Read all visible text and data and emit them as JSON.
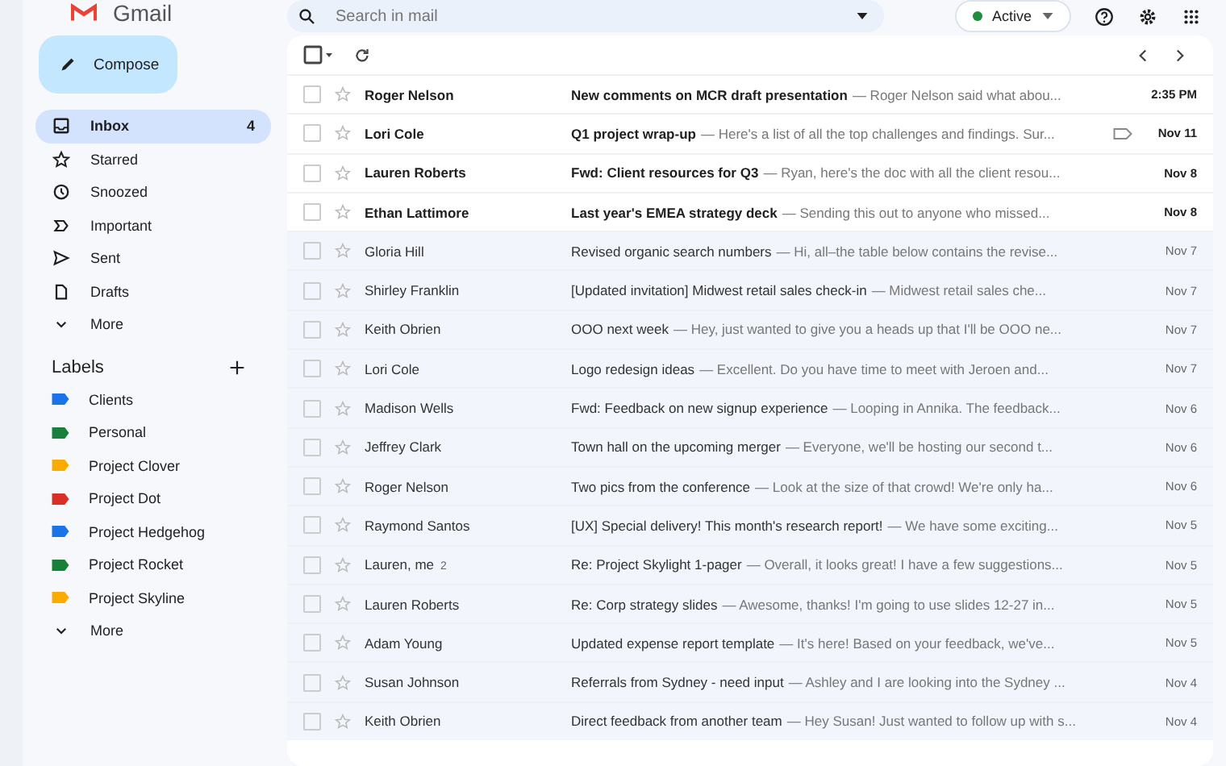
{
  "app": {
    "name": "Gmail"
  },
  "search": {
    "placeholder": "Search in mail"
  },
  "status": {
    "label": "Active",
    "color": "#1e8e3e"
  },
  "compose": {
    "label": "Compose"
  },
  "nav": [
    {
      "label": "Inbox",
      "count": "4",
      "selected": true
    },
    {
      "label": "Starred",
      "selected": false
    },
    {
      "label": "Snoozed",
      "selected": false
    },
    {
      "label": "Important",
      "selected": false
    },
    {
      "label": "Sent",
      "selected": false
    },
    {
      "label": "Drafts",
      "selected": false
    },
    {
      "label": "More",
      "selected": false
    }
  ],
  "select_all": {
    "checked": false
  },
  "labels": {
    "title": "Labels",
    "items": [
      {
        "label": "Clients",
        "color": "#1a73e8"
      },
      {
        "label": "Personal",
        "color": "#188038"
      },
      {
        "label": "Project Clover",
        "color": "#f9ab00"
      },
      {
        "label": "Project Dot",
        "color": "#d93025"
      },
      {
        "label": "Project Hedgehog",
        "color": "#1a73e8"
      },
      {
        "label": "Project Rocket",
        "color": "#188038"
      },
      {
        "label": "Project Skyline",
        "color": "#f9ab00"
      }
    ],
    "more": "More"
  },
  "emails": [
    {
      "sender": "Roger Nelson",
      "subject": "New comments on MCR draft presentation",
      "snippet": "— Roger Nelson said what abou...",
      "date": "2:35 PM",
      "unread": true
    },
    {
      "sender": "Lori Cole",
      "subject": "Q1 project wrap-up",
      "snippet": "— Here's a list of all the top challenges and findings. Sur...",
      "date": "Nov 11",
      "unread": true,
      "attachment": true
    },
    {
      "sender": "Lauren Roberts",
      "subject": "Fwd: Client resources for Q3",
      "snippet": "— Ryan, here's the doc with all the client resou...",
      "date": "Nov 8",
      "unread": true
    },
    {
      "sender": "Ethan Lattimore",
      "subject": "Last year's EMEA strategy deck",
      "snippet": "— Sending this out to anyone who missed...",
      "date": "Nov 8",
      "unread": true
    },
    {
      "sender": "Gloria Hill",
      "subject": "Revised organic search numbers",
      "snippet": "— Hi, all–the table below contains the revise...",
      "date": "Nov 7",
      "unread": false
    },
    {
      "sender": "Shirley Franklin",
      "subject": "[Updated invitation] Midwest retail sales check-in",
      "snippet": "— Midwest retail sales che...",
      "date": "Nov 7",
      "unread": false
    },
    {
      "sender": "Keith Obrien",
      "subject": "OOO next week",
      "snippet": "— Hey, just wanted to give you a heads up that I'll be OOO ne...",
      "date": "Nov 7",
      "unread": false
    },
    {
      "sender": "Lori Cole",
      "subject": "Logo redesign ideas",
      "snippet": "— Excellent. Do you have time to meet with Jeroen and...",
      "date": "Nov 7",
      "unread": false
    },
    {
      "sender": "Madison Wells",
      "subject": "Fwd: Feedback on new signup experience",
      "snippet": "— Looping in Annika. The feedback...",
      "date": "Nov 6",
      "unread": false
    },
    {
      "sender": "Jeffrey Clark",
      "subject": "Town hall on the upcoming merger",
      "snippet": "— Everyone, we'll be hosting our second t...",
      "date": "Nov 6",
      "unread": false
    },
    {
      "sender": "Roger Nelson",
      "subject": "Two pics from the conference",
      "snippet": "— Look at the size of that crowd! We're only ha...",
      "date": "Nov 6",
      "unread": false
    },
    {
      "sender": "Raymond Santos",
      "subject": "[UX] Special delivery! This month's research report!",
      "snippet": "— We have some exciting...",
      "date": "Nov 5",
      "unread": false
    },
    {
      "sender": "Lauren, me",
      "count": "2",
      "subject": "Re: Project Skylight 1-pager",
      "snippet": "— Overall, it looks great! I have a few suggestions...",
      "date": "Nov 5",
      "unread": false
    },
    {
      "sender": "Lauren Roberts",
      "subject": "Re: Corp strategy slides",
      "snippet": "— Awesome, thanks! I'm going to use slides 12-27 in...",
      "date": "Nov 5",
      "unread": false
    },
    {
      "sender": "Adam Young",
      "subject": "Updated expense report template",
      "snippet": "— It's here! Based on your feedback, we've...",
      "date": "Nov 5",
      "unread": false
    },
    {
      "sender": "Susan Johnson",
      "subject": "Referrals from Sydney - need input",
      "snippet": "— Ashley and I are looking into the Sydney ...",
      "date": "Nov 4",
      "unread": false
    },
    {
      "sender": "Keith Obrien",
      "subject": "Direct feedback from another team",
      "snippet": "— Hey Susan! Just wanted to follow up with s...",
      "date": "Nov 4",
      "unread": false
    }
  ]
}
